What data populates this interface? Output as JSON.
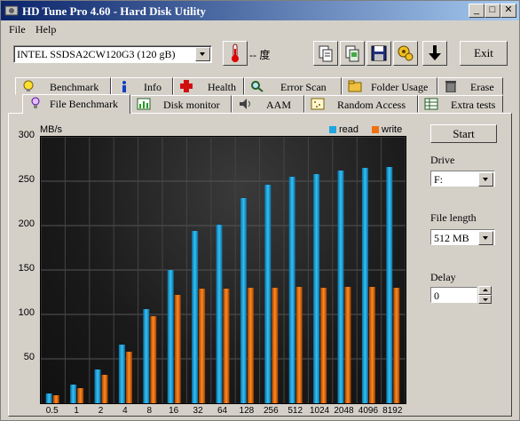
{
  "window": {
    "title": "HD Tune Pro 4.60 - Hard Disk Utility"
  },
  "title_buttons": {
    "minimize": "_",
    "maximize": "□",
    "close": "✕"
  },
  "menu": {
    "file": "File",
    "help": "Help"
  },
  "toolbar": {
    "drive": "INTEL SSDSA2CW120G3     (120 gB)",
    "temperature": "-- 度",
    "exit_label": "Exit"
  },
  "tabs_top": [
    "Benchmark",
    "Info",
    "Health",
    "Error Scan",
    "Folder Usage",
    "Erase"
  ],
  "tabs_bottom": [
    "File Benchmark",
    "Disk monitor",
    "AAM",
    "Random Access",
    "Extra tests"
  ],
  "side": {
    "start_label": "Start",
    "drive_label": "Drive",
    "drive_value": "F:",
    "file_length_label": "File length",
    "file_length_value": "512 MB",
    "delay_label": "Delay",
    "delay_value": "0"
  },
  "colors": {
    "read": "#1fa6e0",
    "write": "#f07010"
  },
  "chart_data": {
    "type": "bar",
    "unit": "MB/s",
    "ylim": [
      0,
      300
    ],
    "yticks": [
      50,
      100,
      150,
      200,
      250,
      300
    ],
    "categories": [
      "0.5",
      "1",
      "2",
      "4",
      "8",
      "16",
      "32",
      "64",
      "128",
      "256",
      "512",
      "1024",
      "2048",
      "4096",
      "8192"
    ],
    "series": [
      {
        "name": "read",
        "values": [
          11,
          21,
          38,
          66,
          106,
          150,
          194,
          201,
          231,
          246,
          255,
          258,
          262,
          265,
          266
        ]
      },
      {
        "name": "write",
        "values": [
          9,
          17,
          32,
          58,
          98,
          122,
          129,
          129,
          130,
          130,
          131,
          130,
          131,
          131,
          130
        ]
      }
    ],
    "legend_position": "top-right"
  }
}
